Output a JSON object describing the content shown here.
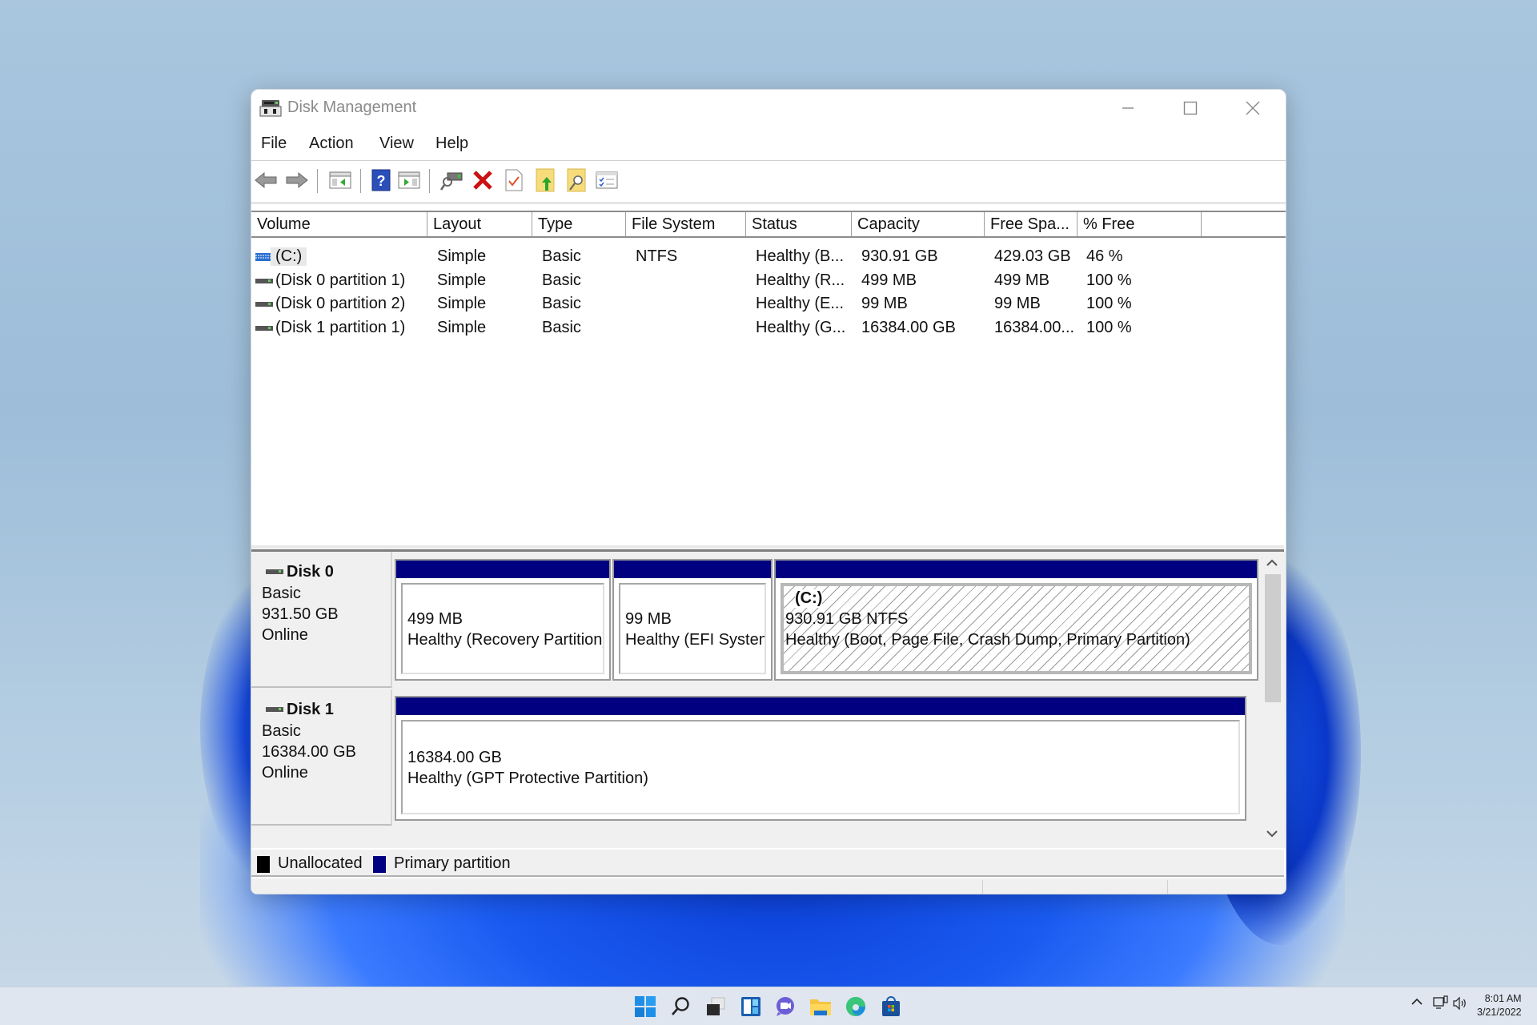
{
  "window": {
    "title": "Disk Management",
    "controls": {
      "minimize": "minimize",
      "maximize": "maximize",
      "close": "close"
    }
  },
  "menu": [
    "File",
    "Action",
    "View",
    "Help"
  ],
  "toolbar": [
    {
      "name": "back-icon"
    },
    {
      "name": "forward-icon"
    },
    {
      "name": "show-hide-console-tree-icon"
    },
    {
      "name": "help-icon"
    },
    {
      "name": "show-hide-action-pane-icon"
    },
    {
      "name": "connect-drive-icon"
    },
    {
      "name": "delete-icon"
    },
    {
      "name": "properties-icon"
    },
    {
      "name": "import-icon"
    },
    {
      "name": "find-icon"
    },
    {
      "name": "settings-list-icon"
    }
  ],
  "volume_list": {
    "columns": [
      "Volume",
      "Layout",
      "Type",
      "File System",
      "Status",
      "Capacity",
      "Free Spa...",
      "% Free"
    ],
    "rows": [
      {
        "volume": "(C:)",
        "icon": "volume-striped-icon",
        "layout": "Simple",
        "type": "Basic",
        "fs": "NTFS",
        "status": "Healthy (B...",
        "capacity": "930.91 GB",
        "free": "429.03 GB",
        "pct": "46 %"
      },
      {
        "volume": "(Disk 0 partition 1)",
        "icon": "drive-icon",
        "layout": "Simple",
        "type": "Basic",
        "fs": "",
        "status": "Healthy (R...",
        "capacity": "499 MB",
        "free": "499 MB",
        "pct": "100 %"
      },
      {
        "volume": "(Disk 0 partition 2)",
        "icon": "drive-icon",
        "layout": "Simple",
        "type": "Basic",
        "fs": "",
        "status": "Healthy (E...",
        "capacity": "99 MB",
        "free": "99 MB",
        "pct": "100 %"
      },
      {
        "volume": "(Disk 1 partition 1)",
        "icon": "drive-icon",
        "layout": "Simple",
        "type": "Basic",
        "fs": "",
        "status": "Healthy (G...",
        "capacity": "16384.00 GB",
        "free": "16384.00...",
        "pct": "100 %"
      }
    ]
  },
  "disks": [
    {
      "name": "Disk 0",
      "type": "Basic",
      "size": "931.50 GB",
      "state": "Online",
      "partitions": [
        {
          "label": "",
          "size": "499 MB",
          "status": "Healthy (Recovery Partition)"
        },
        {
          "label": "",
          "size": "99 MB",
          "status": "Healthy (EFI System Partition)"
        },
        {
          "label": "(C:)",
          "size": "930.91 GB NTFS",
          "status": "Healthy (Boot, Page File, Crash Dump, Primary Partition)"
        }
      ]
    },
    {
      "name": "Disk 1",
      "type": "Basic",
      "size": "16384.00 GB",
      "state": "Online",
      "partitions": [
        {
          "label": "",
          "size": "16384.00 GB",
          "status": "Healthy (GPT Protective Partition)"
        }
      ]
    }
  ],
  "legend": [
    {
      "label": "Unallocated",
      "color": "#000000"
    },
    {
      "label": "Primary partition",
      "color": "#000080"
    }
  ],
  "colors": {
    "primary_partition": "#000080",
    "unallocated": "#000000"
  },
  "taskbar": {
    "apps": [
      "start-icon",
      "search-icon",
      "task-view-icon",
      "widgets-icon",
      "chat-icon",
      "file-explorer-icon",
      "edge-icon",
      "store-icon"
    ],
    "time": "8:01 AM",
    "date": "3/21/2022"
  }
}
